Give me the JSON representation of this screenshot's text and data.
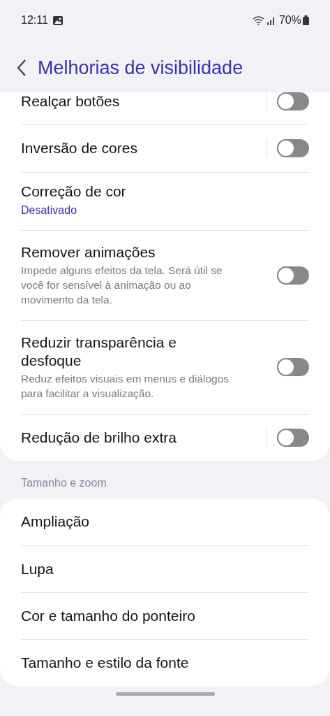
{
  "status_bar": {
    "time": "12:11",
    "battery": "70%"
  },
  "header": {
    "title": "Melhorias de visibilidade"
  },
  "sections": [
    {
      "items": [
        {
          "kind": "toggle",
          "title": "Realçar botões",
          "on": false,
          "split": true
        },
        {
          "kind": "toggle",
          "title": "Inversão de cores",
          "on": false,
          "split": true
        },
        {
          "kind": "link",
          "title": "Correção de cor",
          "value": "Desativado"
        },
        {
          "kind": "toggle",
          "title": "Remover animações",
          "description": "Impede alguns efeitos da tela. Será útil se você for sensível à animação ou ao movimento da tela.",
          "on": false,
          "split": false
        },
        {
          "kind": "toggle",
          "title": "Reduzir transparência e desfoque",
          "description": "Reduz efeitos visuais em menus e diálogos para facilitar a visualização.",
          "on": false,
          "split": false
        },
        {
          "kind": "toggle",
          "title": "Redução de brilho extra",
          "on": false,
          "split": true
        }
      ]
    },
    {
      "label": "Tamanho e zoom",
      "items": [
        {
          "kind": "link",
          "title": "Ampliação"
        },
        {
          "kind": "link",
          "title": "Lupa"
        },
        {
          "kind": "link",
          "title": "Cor e tamanho do ponteiro"
        },
        {
          "kind": "link",
          "title": "Tamanho e estilo da fonte"
        }
      ]
    }
  ]
}
